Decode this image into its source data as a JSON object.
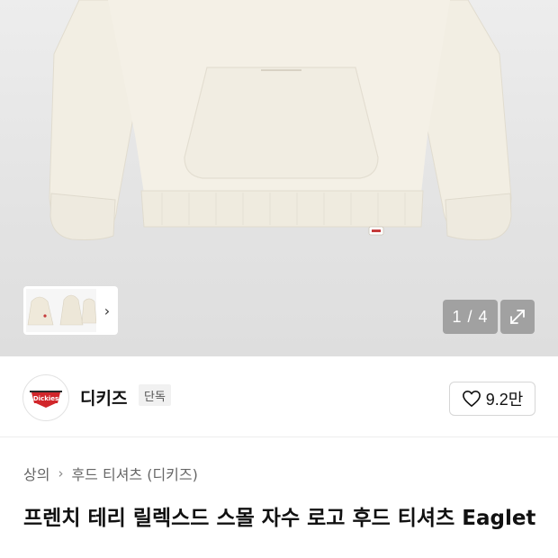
{
  "gallery": {
    "counter": "1 / 4",
    "thumbnail_nav_icon": "chevron-right-icon",
    "expand_icon": "expand-arrows-icon"
  },
  "brand": {
    "logo_text": "Dickies",
    "name": "디키즈",
    "badge": "단독",
    "like_icon": "heart-outline-icon",
    "like_count": "9.2만"
  },
  "breadcrumb": {
    "items": [
      "상의",
      "후드 티셔츠 (디키즈)"
    ],
    "separator_icon": "chevron-right-icon"
  },
  "product": {
    "title": "프렌치 테리 릴렉스드 스몰 자수 로고 후드 티셔츠 Eaglet"
  },
  "colors": {
    "hoodie": "#f3efe4",
    "image_bg": "#e6e6e6",
    "brand_red": "#d1262b"
  }
}
